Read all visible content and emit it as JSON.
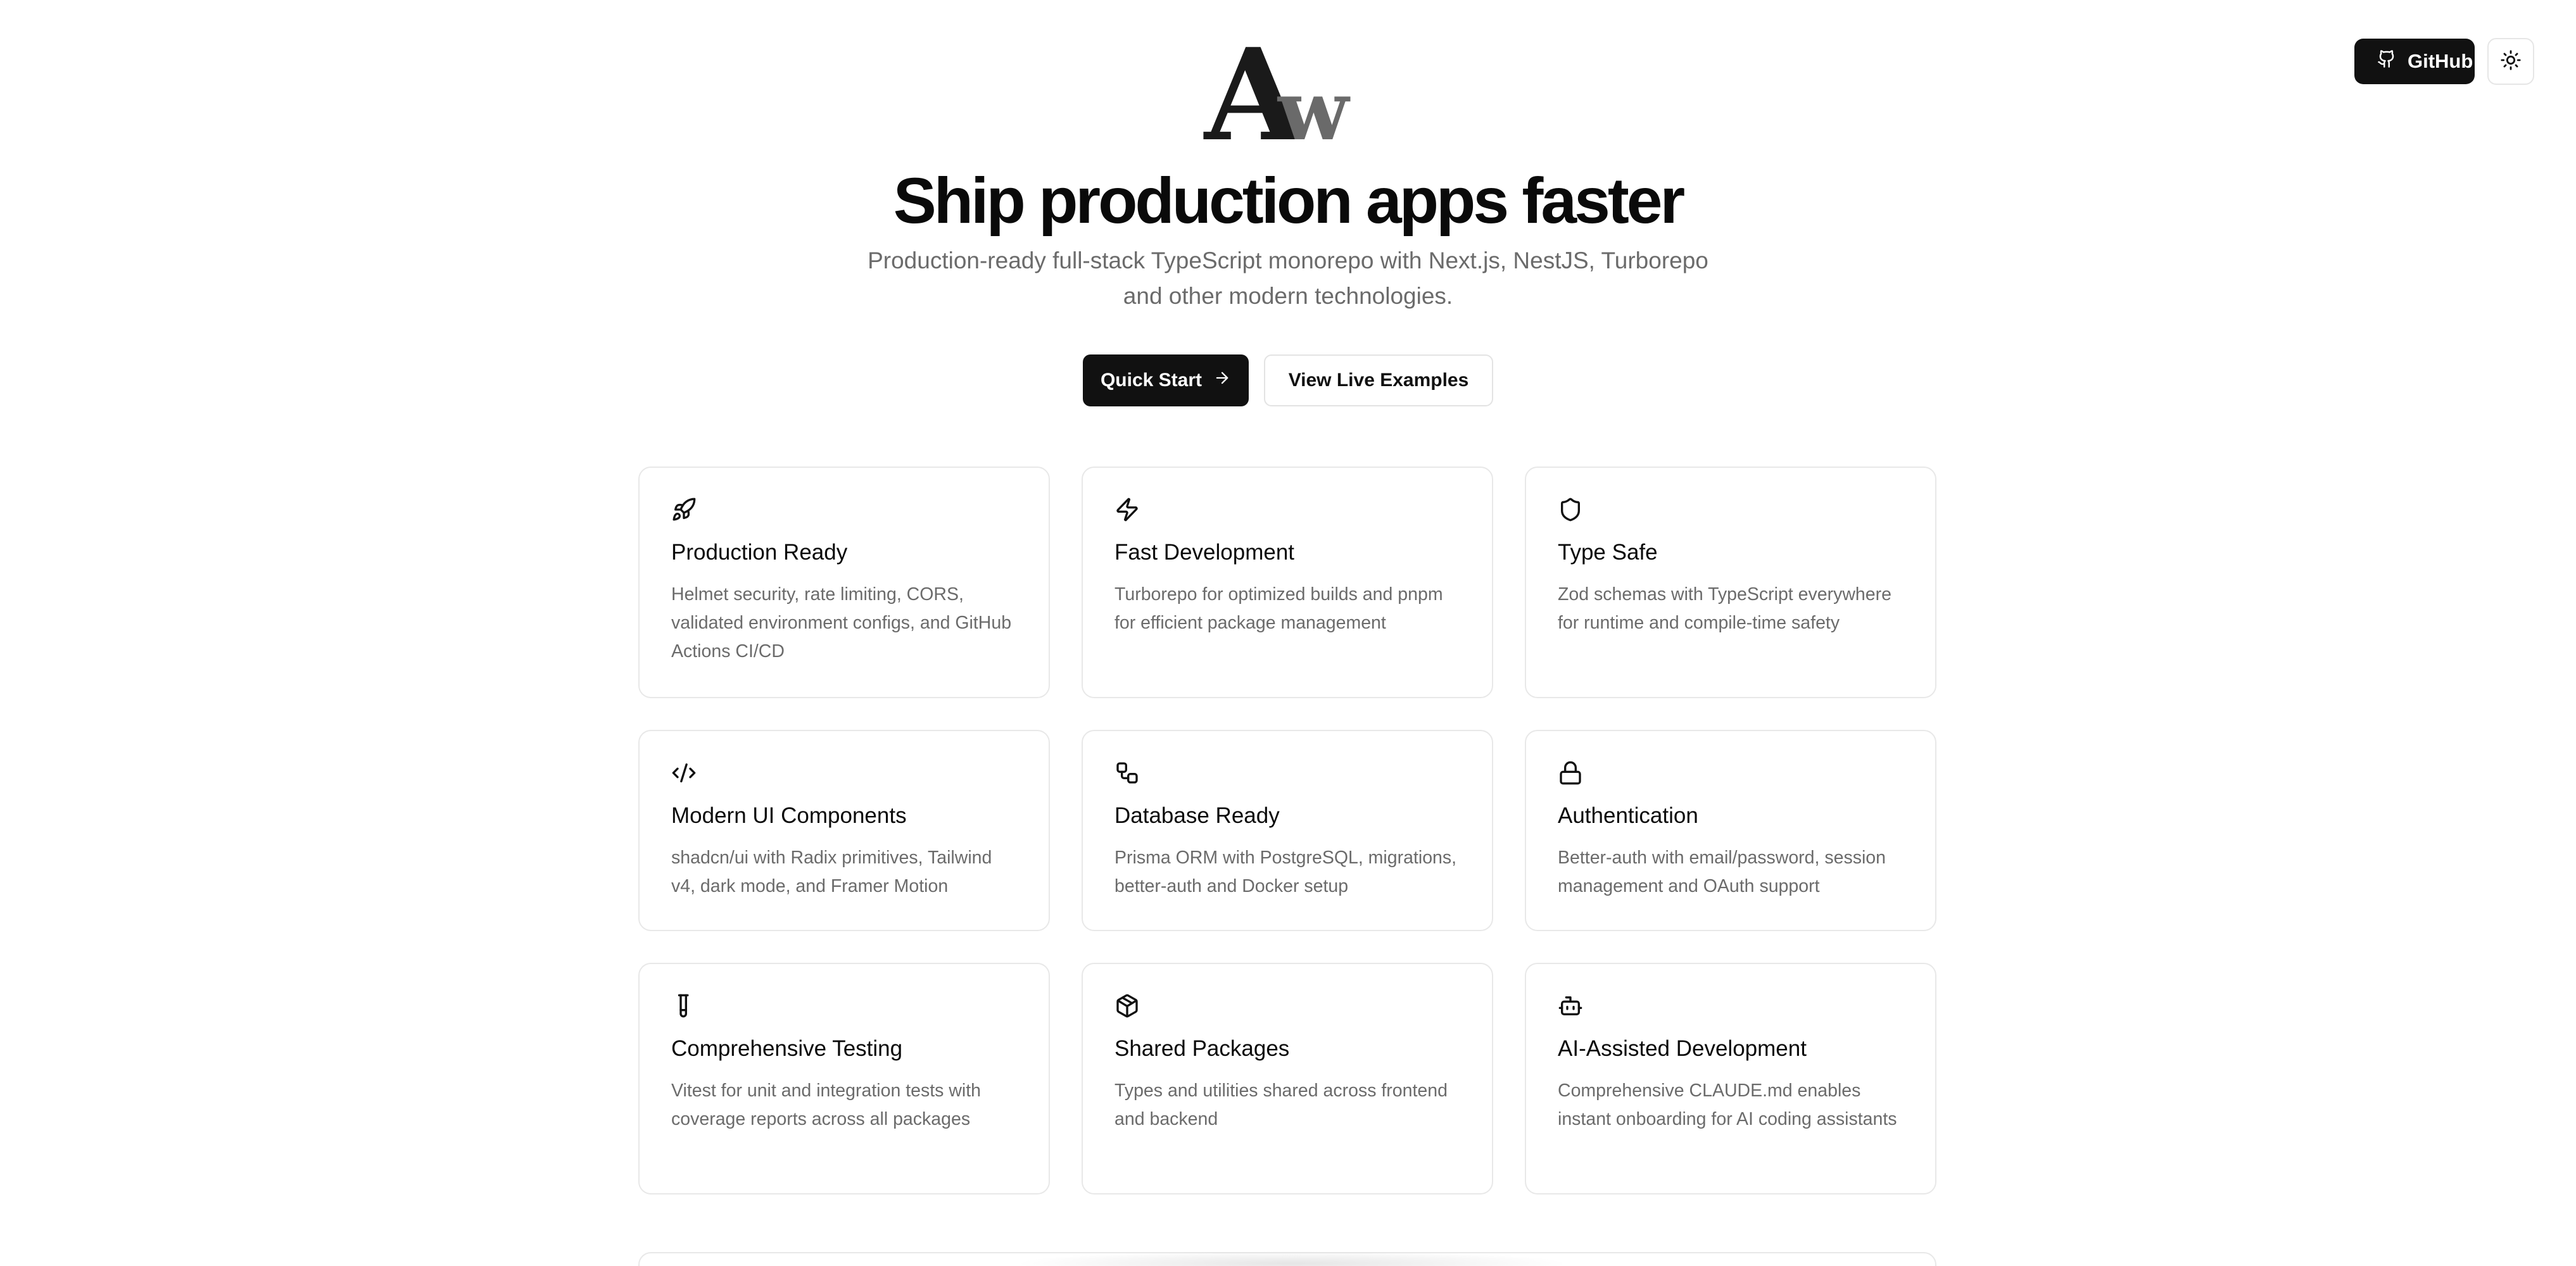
{
  "header": {
    "github_label": "GitHub",
    "theme_toggle_icon": "sun-icon"
  },
  "hero": {
    "logo_letters": "Aw",
    "title": "Ship production apps faster",
    "subtitle_line1": "Production-ready full-stack TypeScript monorepo with Next.js, NestJS, Turborepo",
    "subtitle_line2": "and other modern technologies.",
    "primary_cta": "Quick Start",
    "secondary_cta": "View Live Examples"
  },
  "features": [
    {
      "icon": "rocket-icon",
      "title": "Production Ready",
      "description": "Helmet security, rate limiting, CORS, validated environment configs, and GitHub Actions CI/CD"
    },
    {
      "icon": "lightning-icon",
      "title": "Fast Development",
      "description": "Turborepo for optimized builds and pnpm for efficient package management"
    },
    {
      "icon": "shield-icon",
      "title": "Type Safe",
      "description": "Zod schemas with TypeScript everywhere for runtime and compile-time safety"
    },
    {
      "icon": "code-icon",
      "title": "Modern UI Components",
      "description": "shadcn/ui with Radix primitives, Tailwind v4, dark mode, and Framer Motion"
    },
    {
      "icon": "database-shapes-icon",
      "title": "Database Ready",
      "description": "Prisma ORM with PostgreSQL, migrations, better-auth and Docker setup"
    },
    {
      "icon": "lock-icon",
      "title": "Authentication",
      "description": "Better-auth with email/password, session management and OAuth support"
    },
    {
      "icon": "test-tube-icon",
      "title": "Comprehensive Testing",
      "description": "Vitest for unit and integration tests with coverage reports across all packages"
    },
    {
      "icon": "package-icon",
      "title": "Shared Packages",
      "description": "Types and utilities shared across frontend and backend"
    },
    {
      "icon": "bot-icon",
      "title": "AI-Assisted Development",
      "description": "Comprehensive CLAUDE.md enables instant onboarding for AI coding assistants"
    }
  ],
  "colors": {
    "primary": "#111111",
    "muted_text": "#6b6b6b",
    "border": "#e8e8e8",
    "background": "#ffffff"
  }
}
